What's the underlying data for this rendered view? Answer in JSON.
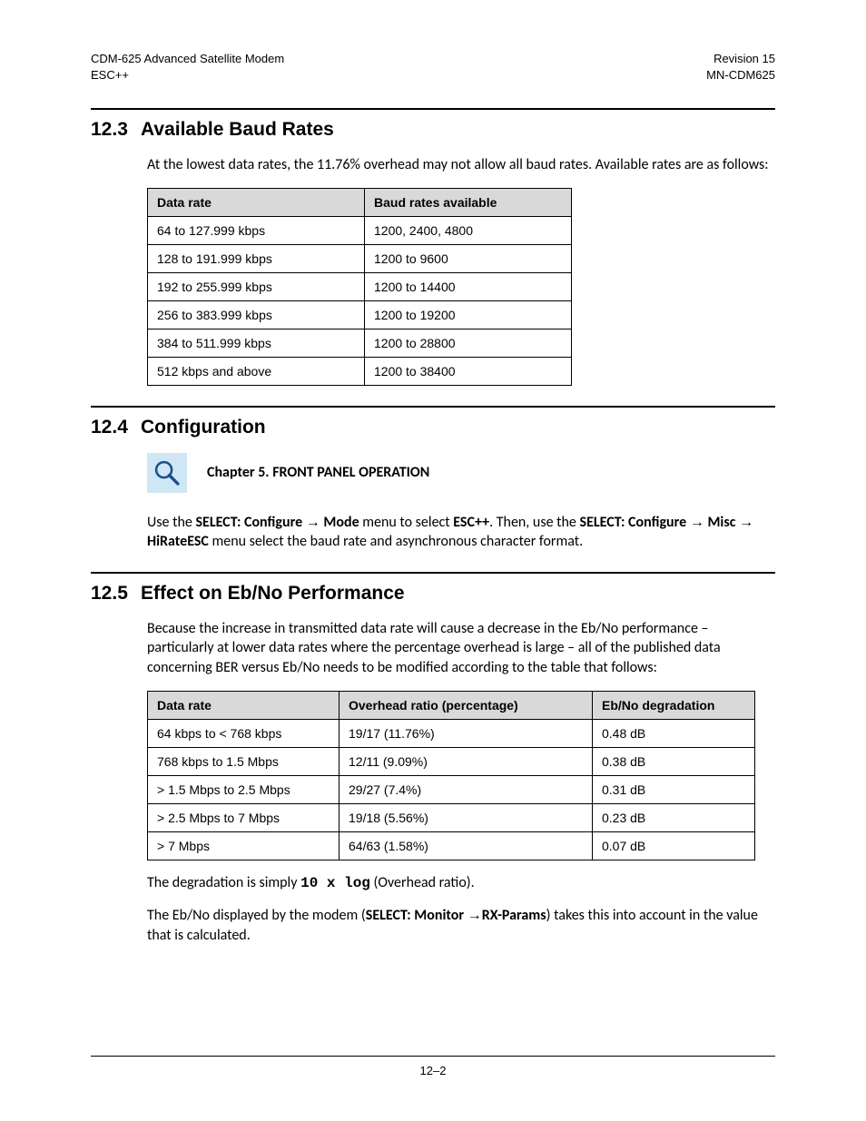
{
  "header": {
    "left1": "CDM-625 Advanced Satellite Modem",
    "left2": "ESC++",
    "right1": "Revision 15",
    "right2": "MN-CDM625"
  },
  "s123": {
    "num": "12.3",
    "title": "Available Baud Rates",
    "intro": "At the lowest data rates, the 11.76% overhead may not allow all baud rates. Available rates are as follows:",
    "headers": [
      "Data rate",
      "Baud rates available"
    ],
    "rows": [
      [
        "64 to 127.999 kbps",
        "1200, 2400, 4800"
      ],
      [
        "128 to 191.999 kbps",
        "1200 to 9600"
      ],
      [
        "192 to 255.999 kbps",
        "1200 to 14400"
      ],
      [
        "256 to 383.999 kbps",
        "1200 to 19200"
      ],
      [
        "384 to 511.999 kbps",
        "1200 to 28800"
      ],
      [
        "512 kbps and above",
        "1200 to 38400"
      ]
    ]
  },
  "s124": {
    "num": "12.4",
    "title": "Configuration",
    "ref": "Chapter 5. FRONT PANEL OPERATION",
    "p1a": "Use the ",
    "p1b": "SELECT: Configure ",
    "p1c": " Mode",
    "p1d": " menu to select ",
    "p1e": "ESC++",
    "p1f": ". Then, use the ",
    "p1g": "SELECT: Configure ",
    "p1h": " Misc ",
    "p1i": " HiRateESC",
    "p1j": " menu select the baud rate and asynchronous character format."
  },
  "s125": {
    "num": "12.5",
    "title": "Effect on Eb/No Performance",
    "intro": "Because the increase in transmitted data rate will cause a decrease in the Eb/No performance – particularly at lower data rates where the percentage overhead is large – all of the published data concerning BER versus Eb/No needs to be modified according to the table that follows:",
    "headers": [
      "Data rate",
      "Overhead ratio (percentage)",
      "Eb/No degradation"
    ],
    "rows": [
      [
        "64 kbps to < 768 kbps",
        "19/17 (11.76%)",
        "0.48 dB"
      ],
      [
        "768 kbps to 1.5 Mbps",
        "12/11 (9.09%)",
        "0.38 dB"
      ],
      [
        "> 1.5 Mbps to 2.5 Mbps",
        "29/27 (7.4%)",
        "0.31 dB"
      ],
      [
        "> 2.5 Mbps to 7 Mbps",
        "19/18 (5.56%)",
        "0.23 dB"
      ],
      [
        "> 7 Mbps",
        "64/63 (1.58%)",
        "0.07 dB"
      ]
    ],
    "p2a": "The degradation is simply ",
    "p2b": "10 x log",
    "p2c": " (Overhead ratio).",
    "p3a": "The Eb/No displayed by the modem (",
    "p3b": "SELECT: Monitor ",
    "p3c": "RX-Params",
    "p3d": ") takes this into account in the value that is calculated."
  },
  "footer": {
    "page": "12–2"
  },
  "arrow": "→"
}
